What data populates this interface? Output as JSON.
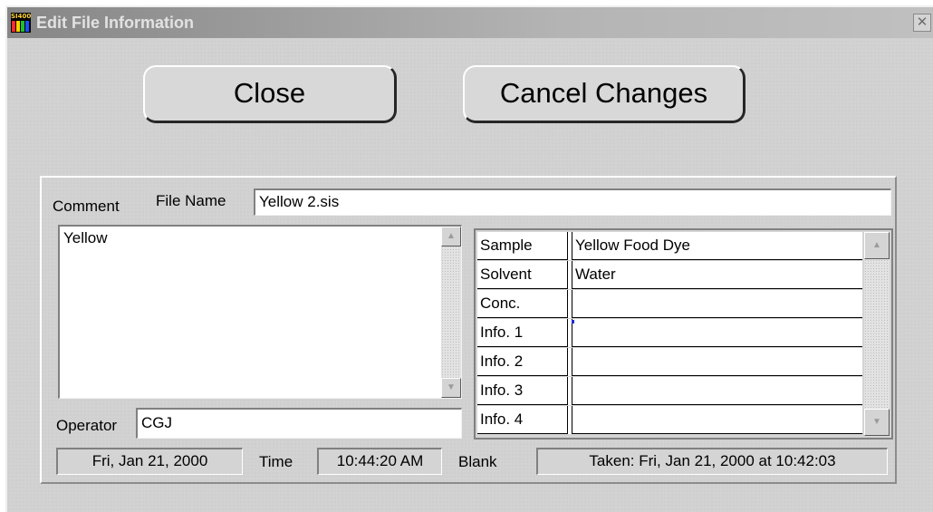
{
  "window": {
    "title": "Edit File Information",
    "icon_label": "SI400",
    "icon_bar_colors": [
      "#ff2a2a",
      "#ffd200",
      "#20c020",
      "#1f4dff"
    ],
    "close_glyph": "✕"
  },
  "buttons": {
    "close_label": "Close",
    "cancel_label": "Cancel Changes"
  },
  "form": {
    "comment_label": "Comment",
    "file_name_label": "File Name",
    "file_name_value": "Yellow 2.sis",
    "comment_text": "Yellow",
    "operator_label": "Operator",
    "operator_value": "CGJ"
  },
  "info_grid": {
    "rows": [
      {
        "label": "Sample",
        "value": "Yellow Food Dye"
      },
      {
        "label": "Solvent",
        "value": "Water"
      },
      {
        "label": "Conc.",
        "value": ""
      },
      {
        "label": "Info. 1",
        "value": ""
      },
      {
        "label": "Info. 2",
        "value": ""
      },
      {
        "label": "Info. 3",
        "value": ""
      },
      {
        "label": "Info. 4",
        "value": ""
      }
    ]
  },
  "status": {
    "date": "Fri, Jan 21, 2000",
    "time_label": "Time",
    "time": "10:44:20 AM",
    "blank_label": "Blank",
    "blank_taken": "Taken: Fri, Jan 21, 2000  at  10:42:03"
  },
  "icons": {
    "scroll_up": "▲",
    "scroll_down": "▼"
  }
}
